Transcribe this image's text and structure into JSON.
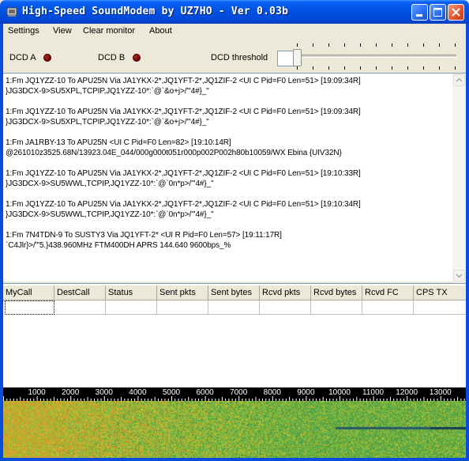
{
  "window": {
    "title": "High-Speed SoundModem by UZ7HO - Ver 0.03b"
  },
  "menu": [
    {
      "label": "Settings"
    },
    {
      "label": "View"
    },
    {
      "label": "Clear monitor"
    },
    {
      "label": "About"
    }
  ],
  "dcd": {
    "a_label": "DCD A",
    "b_label": "DCD B",
    "threshold_label": "DCD threshold"
  },
  "monitor_lines": [
    "1:Fm JQ1YZZ-10 To APU25N Via JA1YKX-2*,JQ1YFT-2*,JQ1ZIF-2 <UI C Pid=F0 Len=51> [19:09:34R]",
    "}JG3DCX-9>SU5XPL,TCPIP,JQ1YZZ-10*:`@`&o+j>/\"'4#}_\"",
    "1:Fm JQ1YZZ-10 To APU25N Via JA1YKX-2*,JQ1YFT-2*,JQ1ZIF-2 <UI C Pid=F0 Len=51> [19:09:34R]",
    "}JG3DCX-9>SU5XPL,TCPIP,JQ1YZZ-10*:`@`&o+j>/\"'4#}_\"",
    "1:Fm JA1RBY-13 To APU25N <UI C Pid=F0 Len=82> [19:10:14R]",
    "@261010z3525.68N/13923.04E_044/000g000t051r000p002P002h80b10059/WX Ebina {UIV32N}",
    "1:Fm JQ1YZZ-10 To APU25N Via JA1YKX-2*,JQ1YFT-2*,JQ1ZIF-2 <UI C Pid=F0 Len=51> [19:10:33R]",
    "}JG3DCX-9>SU5WWL,TCPIP,JQ1YZZ-10*:`@`0n*p>/\"'4#}_\"",
    "1:Fm JQ1YZZ-10 To APU25N Via JA1YKX-2*,JQ1YFT-2*,JQ1ZIF-2 <UI C Pid=F0 Len=51> [19:10:34R]",
    "}JG3DCX-9>SU5WWL,TCPIP,JQ1YZZ-10*:`@`0n*p>/\"'4#}_\"",
    "1:Fm 7N4TDN-9 To SUSTY3 Via JQ1YFT-2* <UI R Pid=F0 Len=57> [19:11:17R]",
    "`C4Jlr}>/\"'5.}438.960MHz FTM400DH APRS 144.640 9600bps_%"
  ],
  "grid": {
    "columns": [
      "MyCall",
      "DestCall",
      "Status",
      "Sent pkts",
      "Sent bytes",
      "Rcvd pkts",
      "Rcvd bytes",
      "Rcvd FC",
      "CPS TX"
    ]
  },
  "spectrum": {
    "scale_labels": [
      "1000",
      "2000",
      "3000",
      "4000",
      "5000",
      "6000",
      "7000",
      "8000",
      "9000",
      "10000",
      "11000",
      "12000",
      "13000"
    ]
  },
  "colors": {
    "titlebar": "#0055e5",
    "led_off": "#6a0000",
    "waterfall_base": "#6cb23a",
    "waterfall_hot": "#d9a020"
  }
}
